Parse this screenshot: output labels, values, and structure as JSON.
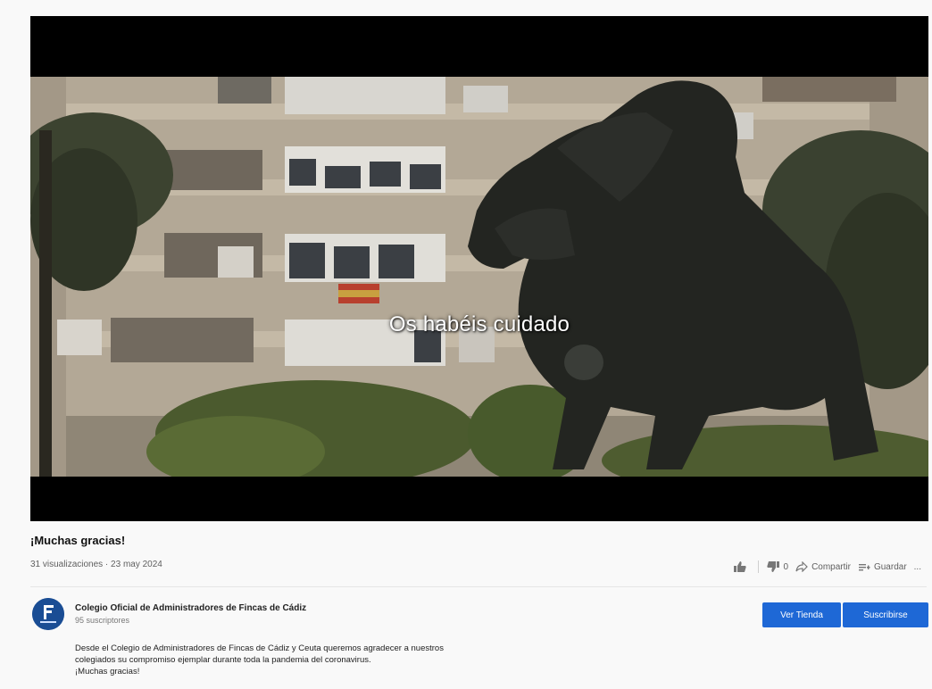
{
  "video": {
    "subtitle": "Os habéis cuidado",
    "title": "¡Muchas gracias!",
    "meta": "31 visualizaciones · 23 may 2024"
  },
  "actions": {
    "like_count": "",
    "dislike_count": "0",
    "share_label": "Compartir",
    "save_label": "Guardar",
    "more_label": "..."
  },
  "channel": {
    "name": "Colegio Oficial de Administradores de Fincas de Cádiz",
    "subscribers": "95 suscriptores",
    "primary_button": "Ver Tienda",
    "secondary_button": "Suscribirse"
  },
  "description": {
    "line1": "Desde el Colegio de Administradores de Fincas de Cádiz y Ceuta queremos agradecer a nuestros",
    "line2": "colegiados su compromiso ejemplar durante toda la pandemia del coronavirus.",
    "line3": "¡Muchas gracias!"
  },
  "colors": {
    "accent": "#1e68d6",
    "avatar": "#1a4d94"
  },
  "icons": [
    "thumbs-up-icon",
    "thumbs-down-icon",
    "share-icon",
    "save-icon",
    "more-icon"
  ]
}
